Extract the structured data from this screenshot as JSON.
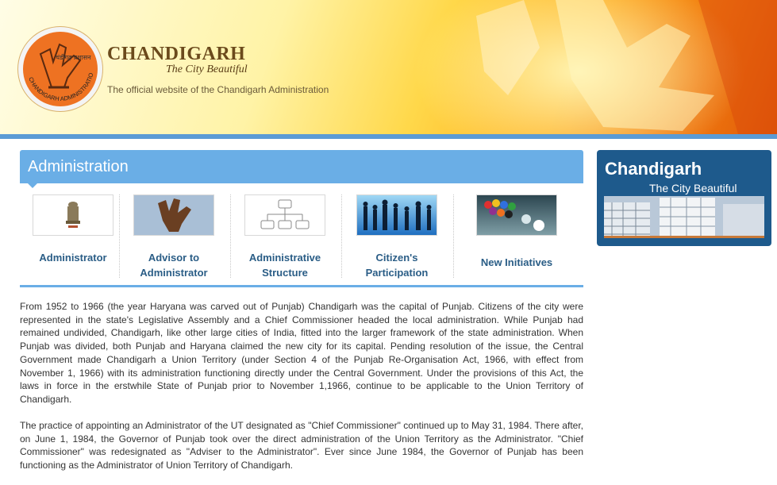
{
  "header": {
    "site_name": "CHANDIGARH",
    "tagline": "The City Beautiful",
    "description": "The official website of the Chandigarh Administration",
    "logo_text_top": "चंडीगढ़ प्रशासन",
    "logo_text_bottom": "CHANDIGARH ADMINISTRATION"
  },
  "main": {
    "title": "Administration",
    "cards": [
      {
        "label_line1": "Administrator",
        "label_line2": "",
        "icon": "emblem-icon"
      },
      {
        "label_line1": "Advisor to",
        "label_line2": "Administrator",
        "icon": "open-hand-icon"
      },
      {
        "label_line1": "Administrative",
        "label_line2": "Structure",
        "icon": "org-chart-icon"
      },
      {
        "label_line1": "Citizen's",
        "label_line2": "Participation",
        "icon": "people-icon"
      },
      {
        "label_line1": "New Initiatives",
        "label_line2": "",
        "icon": "initiatives-icon"
      }
    ],
    "paragraph1": "From 1952 to 1966 (the year Haryana was carved out of Punjab) Chandigarh was the capital of Punjab. Citizens of the city were represented in the state's Legislative Assembly and a Chief Commissioner headed the local administration. While Punjab had remained undivided, Chandigarh, like other large cities of India, fitted into the larger framework of the state administration. When Punjab was divided, both Punjab and Haryana claimed the new city for its capital. Pending resolution of the issue, the Central Government made Chandigarh a Union Territory (under Section 4 of the Punjab Re-Organisation Act, 1966, with effect from November 1, 1966) with its administration functioning directly under the Central Government. Under the provisions of this Act, the laws in force in the erstwhile State of Punjab prior to November 1,1966, continue to be applicable to the Union Territory of Chandigarh.",
    "paragraph2": "The practice of appointing an Administrator of the UT designated as \"Chief Commissioner\" continued up to May 31, 1984. There after, on June 1, 1984, the Governor of Punjab took over the direct administration of the Union Territory as the Administrator. \"Chief Commissioner\" was redesignated as \"Adviser to the Administrator\". Ever since June 1984, the Governor of Punjab has been functioning as the Administrator of Union Territory of Chandigarh."
  },
  "sidebar": {
    "title": "Chandigarh",
    "subtitle": "The City Beautiful"
  },
  "colors": {
    "accent_blue": "#6aaee6",
    "sidebar_blue": "#1e5a8c",
    "link_blue": "#2a5d86",
    "logo_orange": "#ee7222"
  }
}
